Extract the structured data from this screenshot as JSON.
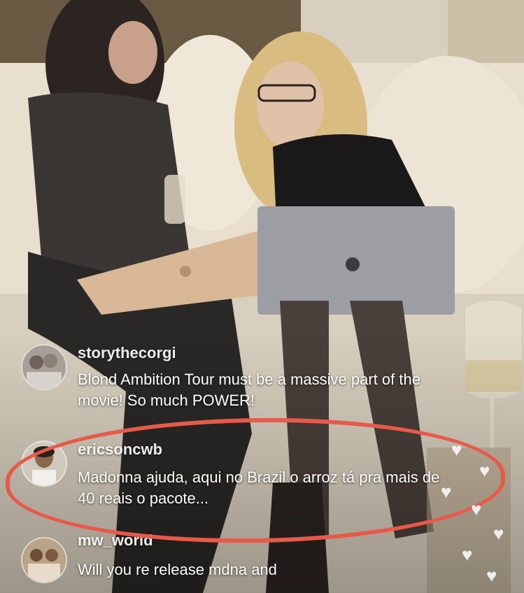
{
  "comments": [
    {
      "username": "storythecorgi",
      "text": "Blond Ambition Tour must be a massive part of the movie! So much POWER!"
    },
    {
      "username": "ericsoncwb",
      "text": "Madonna ajuda, aqui no Brazil o arroz tá pra mais de 40 reais o pacote..."
    },
    {
      "username": "mw_world",
      "text": "Will you re release mdna and"
    }
  ],
  "colors": {
    "highlight_circle": "#e8594a",
    "comment_text": "#ffffff"
  },
  "icons": [
    "heart-icon"
  ]
}
